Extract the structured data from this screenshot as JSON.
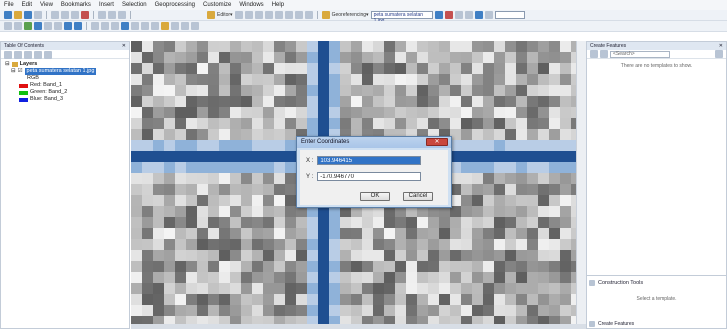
{
  "menu": [
    "File",
    "Edit",
    "View",
    "Bookmarks",
    "Insert",
    "Selection",
    "Geoprocessing",
    "Customize",
    "Windows",
    "Help"
  ],
  "toolbar": {
    "editor_label": "Editor▾",
    "georef_label": "Georeferencing▾",
    "georef_layer": "peta sumatera selatan 1.jpg"
  },
  "toc": {
    "title": "Table Of Contents",
    "close": "✕",
    "root": "Layers",
    "layer": "peta sumatera selatan 1.jpg",
    "rgb": "RGB",
    "bands": [
      {
        "label": "Red:   Band_1",
        "color": "#e01010"
      },
      {
        "label": "Green: Band_2",
        "color": "#10c010"
      },
      {
        "label": "Blue:  Band_3",
        "color": "#1020e0"
      }
    ]
  },
  "create_features": {
    "title": "Create Features",
    "close": "✕",
    "search_placeholder": "<Search>",
    "no_templates": "There are no templates to show.",
    "construction_tools": "Construction Tools",
    "select_template": "Select a template.",
    "bottom_label": "Create Features"
  },
  "dialog": {
    "title": "Enter Coordinates",
    "x_label": "X :",
    "x_value": "103.946415",
    "y_label": "Y :",
    "y_value": "-170.946770",
    "ok": "OK",
    "cancel": "Cancel",
    "close": "✕"
  },
  "colors": {
    "crosshair": "#1f4f91",
    "crosshair_light": "#8fb2d9",
    "selection": "#3173c6"
  }
}
